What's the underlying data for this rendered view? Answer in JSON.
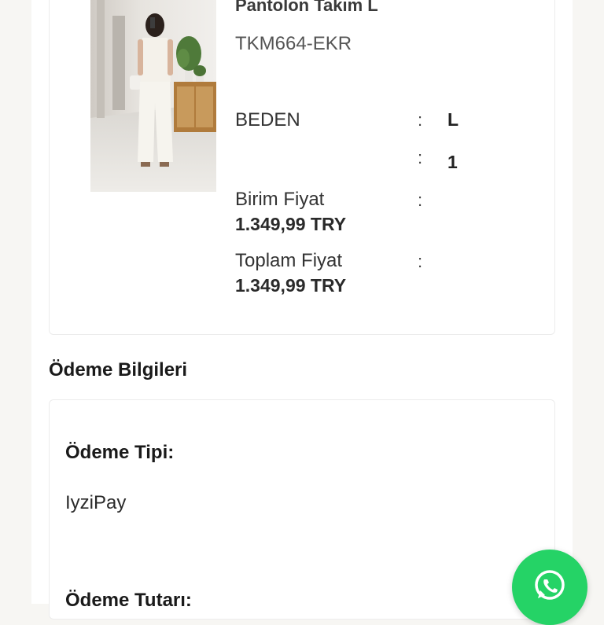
{
  "product": {
    "title": "Pantolon Takım L",
    "sku": "TKM664-EKR",
    "size_label": "BEDEN",
    "size_value": "L",
    "quantity_value": "1",
    "unit_price_label": "Birim Fiyat",
    "unit_price_value": "1.349,99 TRY",
    "total_price_label": "Toplam Fiyat",
    "total_price_value": "1.349,99 TRY",
    "separator": ":"
  },
  "payment": {
    "section_title": "Ödeme Bilgileri",
    "type_label": "Ödeme Tipi:",
    "type_value": "IyziPay",
    "amount_label": "Ödeme Tutarı:"
  },
  "whatsapp": {
    "icon": "whatsapp-icon",
    "color": "#25d366"
  }
}
